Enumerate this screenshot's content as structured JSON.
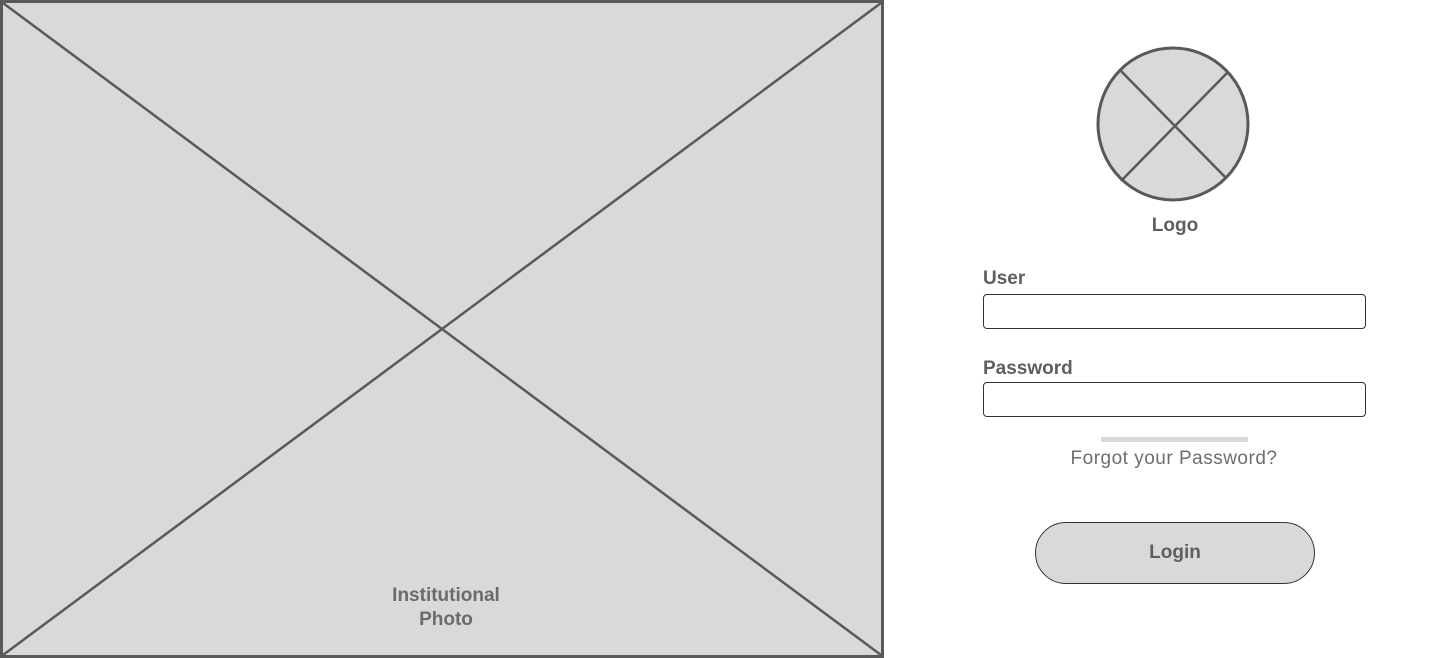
{
  "photo": {
    "label_line1": "Institutional",
    "label_line2": "Photo"
  },
  "logo": {
    "label": "Logo"
  },
  "form": {
    "user_label": "User",
    "user_value": "",
    "password_label": "Password",
    "password_value": "",
    "forgot_link": "Forgot your Password?",
    "login_button": "Login"
  },
  "colors": {
    "placeholder_fill": "#d9d9d9",
    "placeholder_stroke": "#595959",
    "text": "#5f5f5f",
    "border": "#333333"
  }
}
